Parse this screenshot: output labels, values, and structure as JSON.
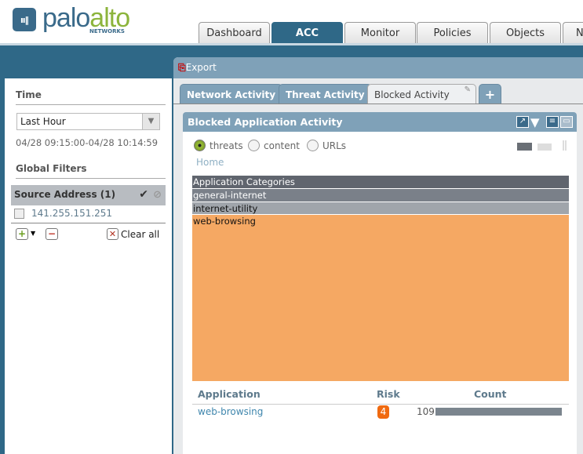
{
  "brand": {
    "name_a": "palo",
    "name_b": "alto",
    "sub": "NETWORKS",
    "colors": {
      "primary": "#2f6887",
      "accent": "#8cb43c"
    }
  },
  "nav": {
    "tabs": [
      "Dashboard",
      "ACC",
      "Monitor",
      "Policies",
      "Objects",
      "N"
    ],
    "active": "ACC"
  },
  "filters": {
    "time_label": "Time",
    "time_value": "Last Hour",
    "time_range": "04/28 09:15:00-04/28 10:14:59",
    "global_label": "Global Filters",
    "source_title": "Source Address (1)",
    "source_items": [
      "141.255.151.251"
    ],
    "clear_all": "Clear all"
  },
  "main": {
    "export": "Export",
    "tabs": [
      "Network Activity",
      "Threat Activity",
      "Blocked Activity",
      "+"
    ],
    "active_tab": "Blocked Activity",
    "widget": {
      "title": "Blocked Application Activity",
      "radios": [
        "threats",
        "content",
        "URLs"
      ],
      "selected": "threats",
      "breadcrumb": "Home",
      "treemap": {
        "header": "Application Categories",
        "items": [
          {
            "label": "general-internet",
            "color": "#7a8089"
          },
          {
            "label": "internet-utility",
            "color": "#a0a5ab"
          },
          {
            "label": "web-browsing",
            "color": "#f5a863"
          }
        ]
      },
      "table": {
        "headers": [
          "Application",
          "Risk",
          "Count"
        ],
        "rows": [
          {
            "application": "web-browsing",
            "risk": "4",
            "count": "109",
            "bar_fraction": 1.0
          }
        ]
      }
    }
  }
}
